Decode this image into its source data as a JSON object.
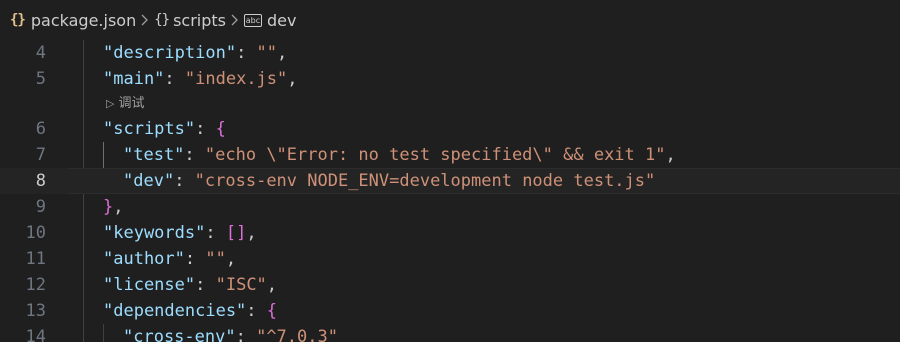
{
  "breadcrumb": {
    "file_icon": "json-braces-icon",
    "file": "package.json",
    "scripts_icon": "object-braces-icon",
    "scripts": "scripts",
    "dev_icon": "string-abc-icon",
    "dev_icon_text": "abc",
    "dev": "dev",
    "separator_icon": "chevron-right-icon"
  },
  "codelens": {
    "label": "调试",
    "icon": "play-icon"
  },
  "lines": [
    {
      "num": "4",
      "key": "\"description\"",
      "sep": ": ",
      "value": "\"\"",
      "end": ","
    },
    {
      "num": "5",
      "key": "\"main\"",
      "sep": ": ",
      "value": "\"index.js\"",
      "end": ","
    },
    {
      "num": "6",
      "key": "\"scripts\"",
      "sep": ": ",
      "open": "{"
    },
    {
      "num": "7",
      "key": "\"test\"",
      "sep": ": ",
      "value": "\"echo \\\"Error: no test specified\\\" && exit 1\"",
      "end": ","
    },
    {
      "num": "8",
      "key": "\"dev\"",
      "sep": ": ",
      "value": "\"cross-env NODE_ENV=development node test.js\""
    },
    {
      "num": "9",
      "close": "}",
      "end": ","
    },
    {
      "num": "10",
      "key": "\"keywords\"",
      "sep": ": ",
      "open": "[]",
      "end": ","
    },
    {
      "num": "11",
      "key": "\"author\"",
      "sep": ": ",
      "value": "\"\"",
      "end": ","
    },
    {
      "num": "12",
      "key": "\"license\"",
      "sep": ": ",
      "value": "\"ISC\"",
      "end": ","
    },
    {
      "num": "13",
      "key": "\"dependencies\"",
      "sep": ": ",
      "open": "{"
    },
    {
      "num": "14",
      "key": "\"cross-env\"",
      "sep": ": ",
      "value": "\"^7.0.3\""
    }
  ],
  "colors": {
    "background": "#1f1f1f",
    "key": "#9cdcfe",
    "string": "#ce9178",
    "bracket": "#da70d6",
    "line_number": "#6e7681"
  }
}
